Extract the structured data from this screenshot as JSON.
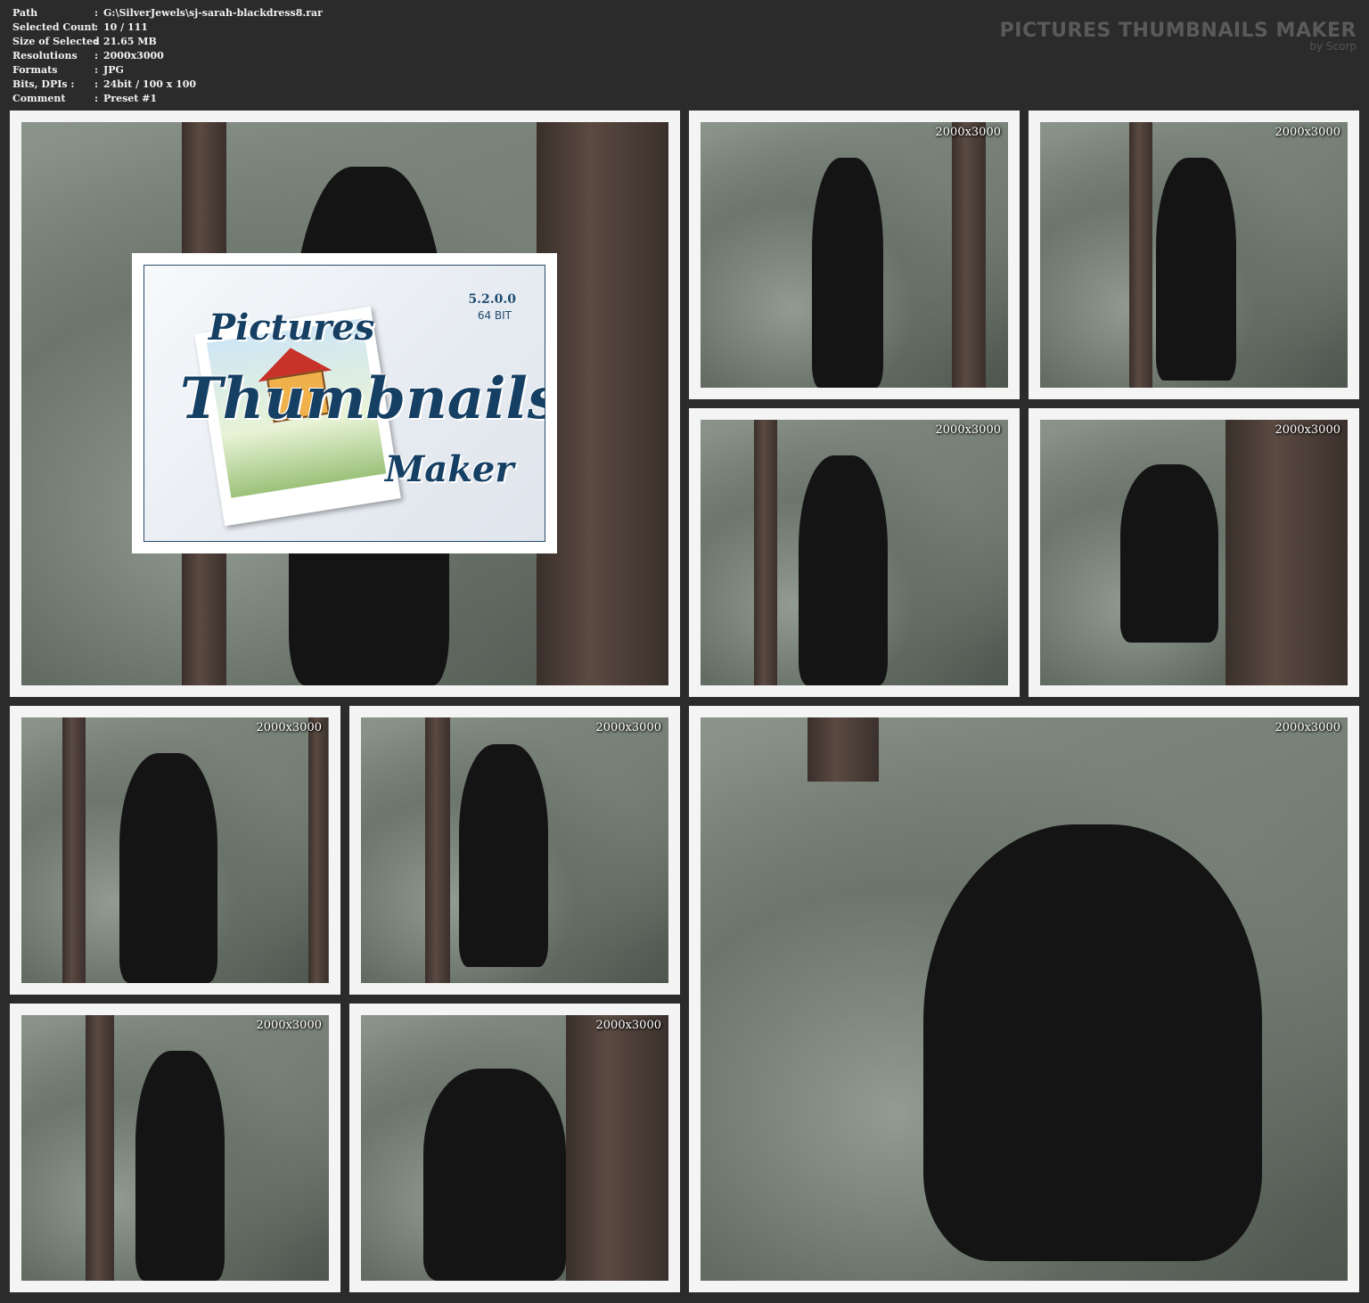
{
  "info": [
    {
      "key": "Path",
      "value": "G:\\SilverJewels\\sj-sarah-blackdress8.rar"
    },
    {
      "key": "Selected Count",
      "value": "10 / 111"
    },
    {
      "key": "Size of Selected",
      "value": "21.65 MB"
    },
    {
      "key": "Resolutions",
      "value": "2000x3000"
    },
    {
      "key": "Formats",
      "value": "JPG"
    },
    {
      "key": "Bits, DPIs :",
      "value": "24bit / 100 x 100"
    },
    {
      "key": "Comment",
      "value": "Preset #1"
    }
  ],
  "separator": ":",
  "brand": {
    "title": "PICTURES THUMBNAILS MAKER",
    "subtitle": "by Scorp"
  },
  "logo": {
    "version": "5.2.0.0",
    "bits": "64 BIT",
    "word1": "Pictures",
    "word2": "Thumbnails",
    "word3": "Maker"
  },
  "thumbs": [
    {
      "label": ""
    },
    {
      "label": "2000x3000"
    },
    {
      "label": "2000x3000"
    },
    {
      "label": "2000x3000"
    },
    {
      "label": "2000x3000"
    },
    {
      "label": "2000x3000"
    },
    {
      "label": "2000x3000"
    },
    {
      "label": "2000x3000"
    },
    {
      "label": "2000x3000"
    },
    {
      "label": "2000x3000"
    }
  ]
}
